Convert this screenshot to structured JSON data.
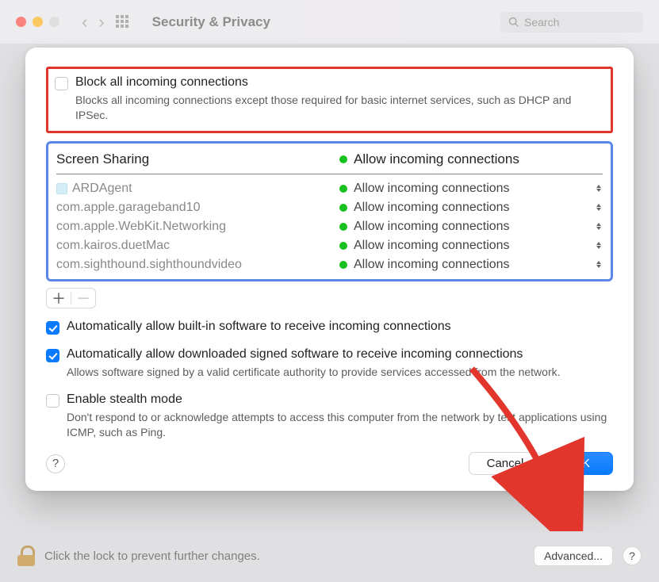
{
  "toolbar": {
    "title": "Security & Privacy",
    "search_placeholder": "Search"
  },
  "blockAll": {
    "label": "Block all incoming connections",
    "sub": "Blocks all incoming connections except those required for basic internet services, such as DHCP and IPSec."
  },
  "list": {
    "header": {
      "name": "Screen Sharing",
      "status": "Allow incoming connections"
    },
    "rows": [
      {
        "name": "ARDAgent",
        "status": "Allow incoming connections",
        "hasIcon": true
      },
      {
        "name": "com.apple.garageband10",
        "status": "Allow incoming connections"
      },
      {
        "name": "com.apple.WebKit.Networking",
        "status": "Allow incoming connections"
      },
      {
        "name": "com.kairos.duetMac",
        "status": "Allow incoming connections"
      },
      {
        "name": "com.sighthound.sighthoundvideo",
        "status": "Allow incoming connections"
      }
    ]
  },
  "autoBuiltin": {
    "label": "Automatically allow built-in software to receive incoming connections"
  },
  "autoSigned": {
    "label": "Automatically allow downloaded signed software to receive incoming connections",
    "sub": "Allows software signed by a valid certificate authority to provide services accessed from the network."
  },
  "stealth": {
    "label": "Enable stealth mode",
    "sub": "Don't respond to or acknowledge attempts to access this computer from the network by test applications using ICMP, such as Ping."
  },
  "buttons": {
    "cancel": "Cancel",
    "ok": "OK"
  },
  "footer": {
    "lock_text": "Click the lock to prevent further changes.",
    "advanced": "Advanced..."
  }
}
